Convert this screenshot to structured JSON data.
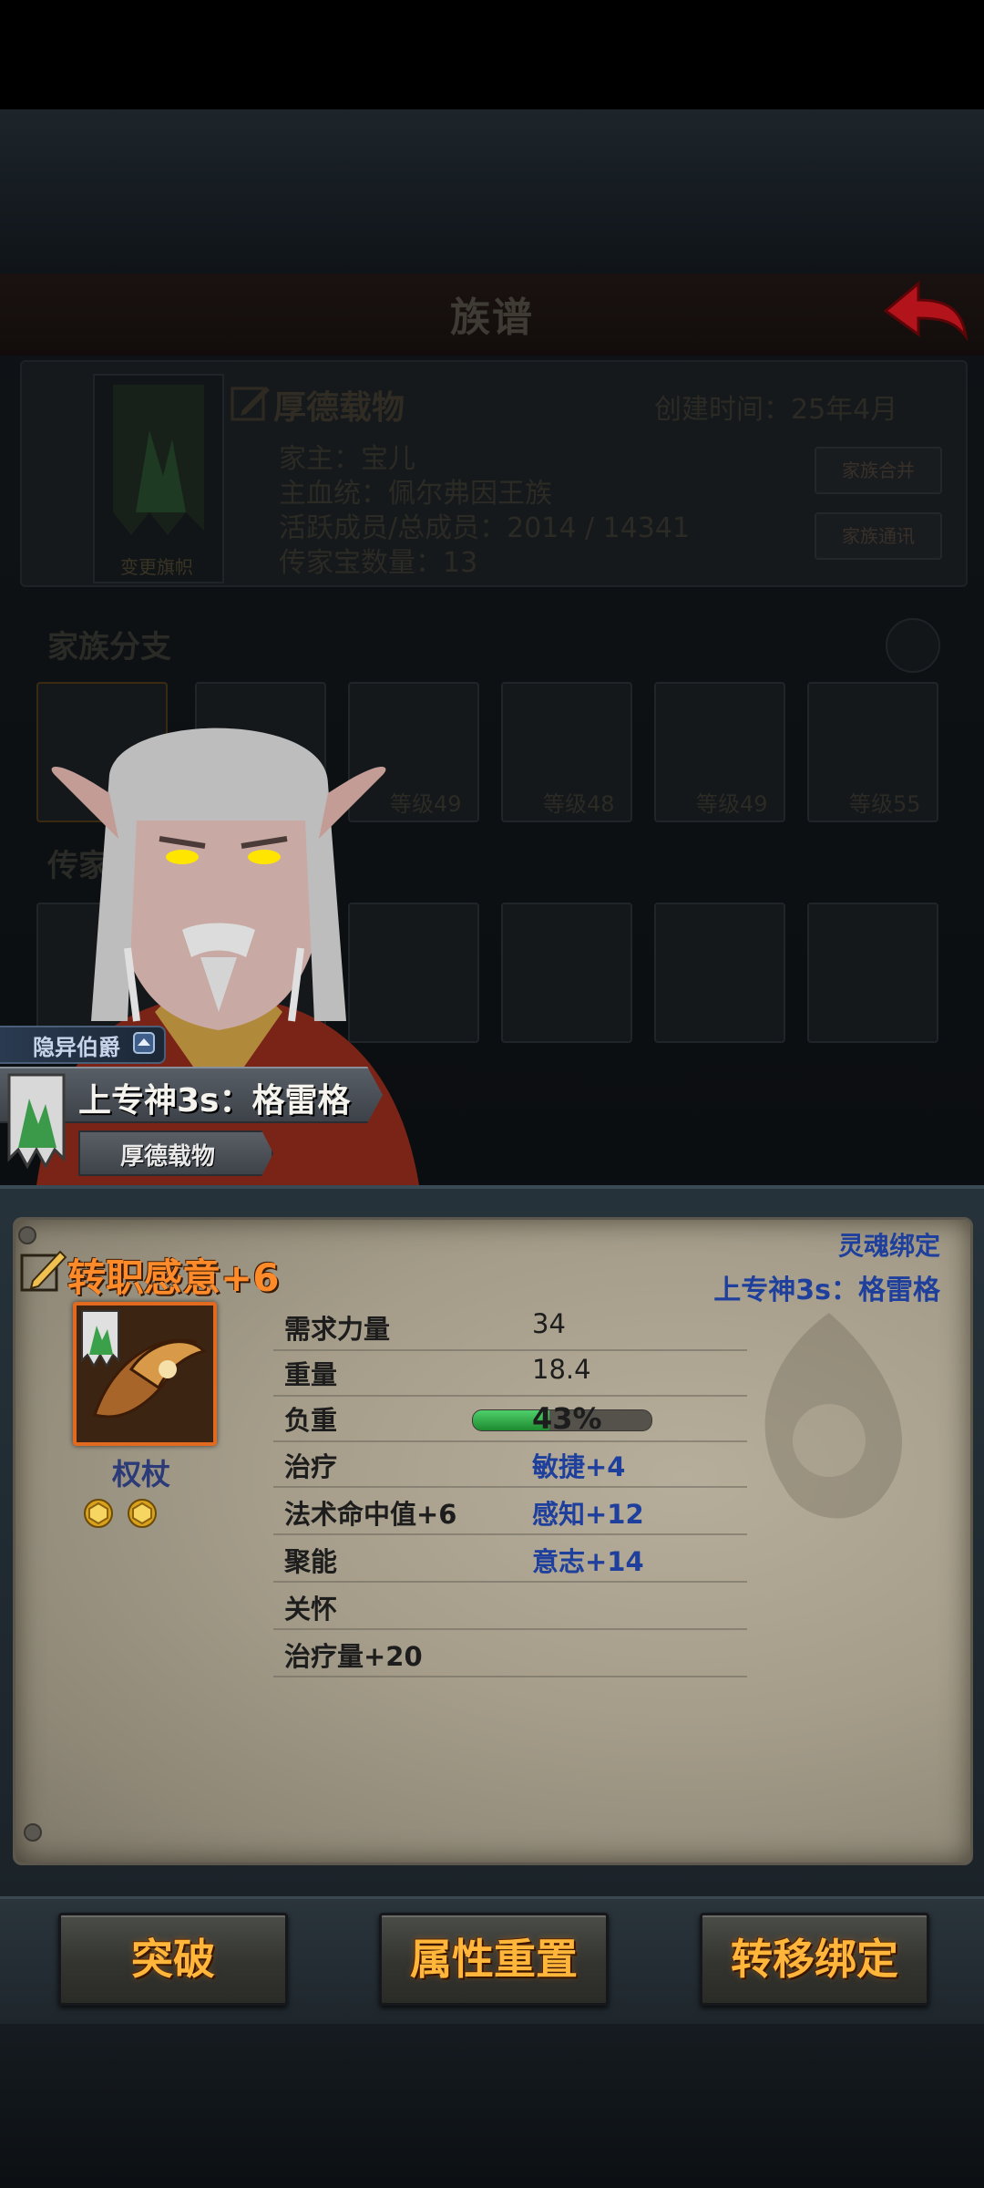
{
  "background": {
    "title": "族谱",
    "family": {
      "name": "厚德载物",
      "banner_label": "变更旗帜",
      "created": "创建时间：25年4月",
      "leader": "家主：宝儿",
      "main_line": "主血统：佩尔弗因王族",
      "members": "活跃成员/总成员：2014 / 14341",
      "heirloom_count": "传家宝数量：13",
      "merge_button": "家族合并",
      "info_button": "家族通讯"
    },
    "branch_header": "家族分支",
    "branch_levels": [
      "等级49",
      "等级48",
      "等级49",
      "等级55"
    ],
    "heirloom_header": "传家宝"
  },
  "character": {
    "rank": "隐异伯爵",
    "name": "上专神3s：格雷格",
    "family": "厚德载物"
  },
  "item": {
    "title": "转职感意+6",
    "bind_status": "灵魂绑定",
    "bind_owner": "上专神3s：格雷格",
    "type": "权杖",
    "gem_slots": 2,
    "stats": [
      {
        "label": "需求力量",
        "value": "34"
      },
      {
        "label": "重量",
        "value": "18.4"
      },
      {
        "label": "负重",
        "value": "43%"
      },
      {
        "label": "治疗",
        "value": "敏捷+4"
      },
      {
        "label": "法术命中值+6",
        "value": "感知+12"
      },
      {
        "label": "聚能",
        "value": "意志+14"
      },
      {
        "label": "关怀",
        "value": ""
      },
      {
        "label": "治疗量+20",
        "value": ""
      }
    ],
    "load_percent": 43
  },
  "buttons": {
    "breakthrough": "突破",
    "reset": "属性重置",
    "transfer": "转移绑定"
  },
  "colors": {
    "item_title": "#ff8a2a",
    "bonus_text": "#1f3f9c",
    "button_text": "#ffb63b",
    "item_frame": "#e26a20"
  }
}
